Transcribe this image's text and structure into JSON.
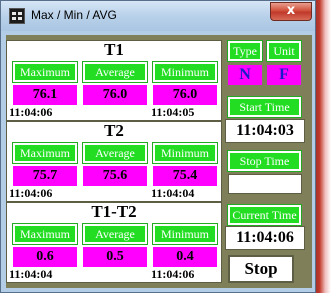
{
  "window": {
    "title": "Max / Min / AVG",
    "close_glyph": "x"
  },
  "labels": {
    "maximum": "Maximum",
    "average": "Average",
    "minimum": "Minimum"
  },
  "panels": [
    {
      "title": "T1",
      "max": "76.1",
      "avg": "76.0",
      "min": "76.0",
      "time_max": "11:04:06",
      "time_min": "11:04:05"
    },
    {
      "title": "T2",
      "max": "75.7",
      "avg": "75.6",
      "min": "75.4",
      "time_max": "11:04:06",
      "time_min": "11:04:04"
    },
    {
      "title": "T1-T2",
      "max": "0.6",
      "avg": "0.5",
      "min": "0.4",
      "time_max": "11:04:04",
      "time_min": "11:04:06"
    }
  ],
  "side": {
    "type_label": "Type",
    "type_value": "N",
    "unit_label": "Unit",
    "unit_value": "F",
    "start_label": "Start Time",
    "start_value": "11:04:03",
    "stop_label": "Stop Time",
    "stop_value": "",
    "current_label": "Current Time",
    "current_value": "11:04:06",
    "stop_button": "Stop"
  },
  "colors": {
    "green": "#22dd22",
    "magenta": "#ff00ff",
    "frame": "#7f7f5a"
  }
}
